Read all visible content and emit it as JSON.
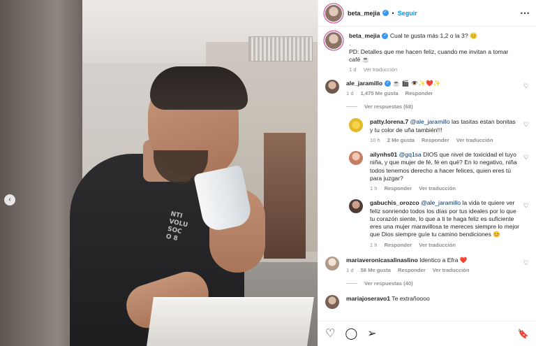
{
  "header": {
    "username": "beta_mejia",
    "follow_label": "Seguir",
    "dot": "•",
    "more_icon": "⋯"
  },
  "caption": {
    "username": "beta_mejia",
    "text_line1": "Cual te gusta más 1,2 o la 3? 😊",
    "text_dot": ".",
    "text_line2": "PD: Detalles que me hacen feliz, cuando me invitan a tomar café ☕",
    "time": "1 d",
    "translate": "Ver traducción"
  },
  "comments": [
    {
      "username": "ale_jaramillo",
      "text": "☕ 🎬 👁️✨❤️✨",
      "time": "1 d",
      "likes": "1,475 Me gusta",
      "reply": "Responder",
      "view_replies": "Ver respuestas (68)",
      "replies": [
        {
          "username": "patty.lorena.7",
          "mention": "@ale_jaramillo",
          "text": " las tasitas estan bonitas y tu color de uña también!!!",
          "time": "10 h",
          "likes": "2 Me gusta",
          "reply": "Responder",
          "translate": "Ver traducción"
        },
        {
          "username": "ailynhs01",
          "mention": "@gq1sa",
          "text": " DIOS que nivel de toxicidad el tuyo niña, y que mujer de fé, fé en qué? En lo negativo, niña todos tenemos derecho a hacer felices, quien eres tú para juzgar?",
          "time": "1 h",
          "reply": "Responder",
          "translate": "Ver traducción"
        },
        {
          "username": "gabuchis_orozco",
          "mention": "@ale_jaramillo",
          "text": " la vida te quiere ver feliz sonriendo todos los días por tus ideales por lo que tu corazón siente, lo que a ti te haga feliz es suficiente eres una mujer maravillosa te mereces siempre lo mejor que Dios siempre guíe tu camino bendiciones 😊",
          "time": "1 h",
          "reply": "Responder",
          "translate": "Ver traducción"
        }
      ]
    },
    {
      "username": "mariaveronicasalinaslino",
      "text": " Identico a Efra ❤️",
      "time": "1 d",
      "likes": "58 Me gusta",
      "reply": "Responder",
      "translate": "Ver traducción",
      "view_replies": "Ver respuestas (40)"
    },
    {
      "username": "mariajoseravo1",
      "text": " Te extrañoooo"
    }
  ],
  "photo": {
    "nav_left_icon": "‹",
    "shirt_print": "NTI\nVOLU\nSOC\nO 8"
  },
  "footer": {
    "like_icon": "♡",
    "comment_icon": "◯",
    "share_icon": "➢",
    "save_icon": "🔖"
  },
  "colors": {
    "follow": "#0095f6",
    "verified": "#3897f0",
    "mention": "#00376b",
    "muted": "#8e8e8e"
  }
}
